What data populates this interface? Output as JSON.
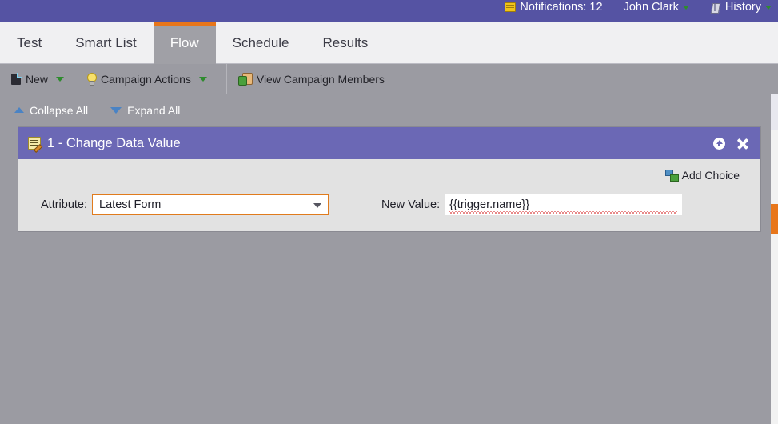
{
  "topbar": {
    "notifications": {
      "label": "Notifications: 12",
      "icon": "notifications-icon"
    },
    "user": {
      "label": "John Clark",
      "icon": "chevron-down-icon"
    },
    "history": {
      "label": "History",
      "icon": "history-icon"
    }
  },
  "tabs": [
    {
      "label": "Test",
      "active": false
    },
    {
      "label": "Smart List",
      "active": false
    },
    {
      "label": "Flow",
      "active": true
    },
    {
      "label": "Schedule",
      "active": false
    },
    {
      "label": "Results",
      "active": false
    }
  ],
  "toolbar": {
    "new_label": "New",
    "campaign_actions_label": "Campaign Actions",
    "view_members_label": "View Campaign Members"
  },
  "tree_controls": {
    "collapse_label": "Collapse All",
    "expand_label": "Expand All"
  },
  "flow_step": {
    "title": "1 - Change Data Value",
    "add_choice_label": "Add Choice",
    "attribute": {
      "label": "Attribute:",
      "value": "Latest Form"
    },
    "new_value": {
      "label": "New Value:",
      "value": "{{trigger.name}}"
    }
  },
  "colors": {
    "topbar_purple": "#5553a3",
    "panel_header_purple": "#6b68b5",
    "accent_orange": "#e8761a",
    "background_gray": "#9b9ba2",
    "panel_body_gray": "#e2e2e2"
  }
}
